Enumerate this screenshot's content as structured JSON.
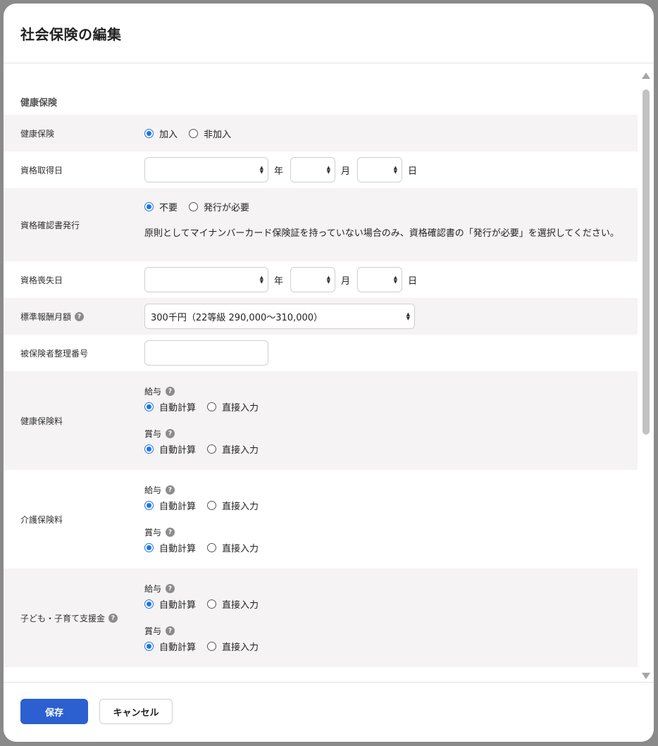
{
  "modal": {
    "title": "社会保険の編集"
  },
  "section": {
    "title": "健康保険"
  },
  "rows": {
    "health_insurance": {
      "label": "健康保険",
      "options": [
        "加入",
        "非加入"
      ]
    },
    "acquisition_date": {
      "label": "資格取得日",
      "year_unit": "年",
      "month_unit": "月",
      "day_unit": "日",
      "year_value": "",
      "month_value": "",
      "day_value": ""
    },
    "certificate_issue": {
      "label": "資格確認書発行",
      "options": [
        "不要",
        "発行が必要"
      ],
      "note": "原則としてマイナンバーカード保険証を持っていない場合のみ、資格確認書の「発行が必要」を選択してください。"
    },
    "loss_date": {
      "label": "資格喪失日",
      "year_unit": "年",
      "month_unit": "月",
      "day_unit": "日",
      "year_value": "",
      "month_value": "",
      "day_value": ""
    },
    "standard_monthly": {
      "label": "標準報酬月額",
      "selected": "300千円（22等級 290,000〜310,000）"
    },
    "insured_number": {
      "label": "被保険者整理番号",
      "value": ""
    },
    "health_premium": {
      "label": "健康保険料",
      "salary_label": "給与",
      "bonus_label": "賞与",
      "options": [
        "自動計算",
        "直接入力"
      ]
    },
    "care_premium": {
      "label": "介護保険料",
      "salary_label": "給与",
      "bonus_label": "賞与",
      "options": [
        "自動計算",
        "直接入力"
      ]
    },
    "child_support": {
      "label": "子ども・子育て支援金",
      "salary_label": "給与",
      "bonus_label": "賞与",
      "options": [
        "自動計算",
        "直接入力"
      ]
    }
  },
  "footer": {
    "save_label": "保存",
    "cancel_label": "キャンセル"
  },
  "icons": {
    "help": "?",
    "caret_up": "▲",
    "caret_down": "▼"
  },
  "colors": {
    "accent": "#1a73e8",
    "primary_button": "#2c5fd0",
    "shade_row": "#f5f3f3"
  }
}
